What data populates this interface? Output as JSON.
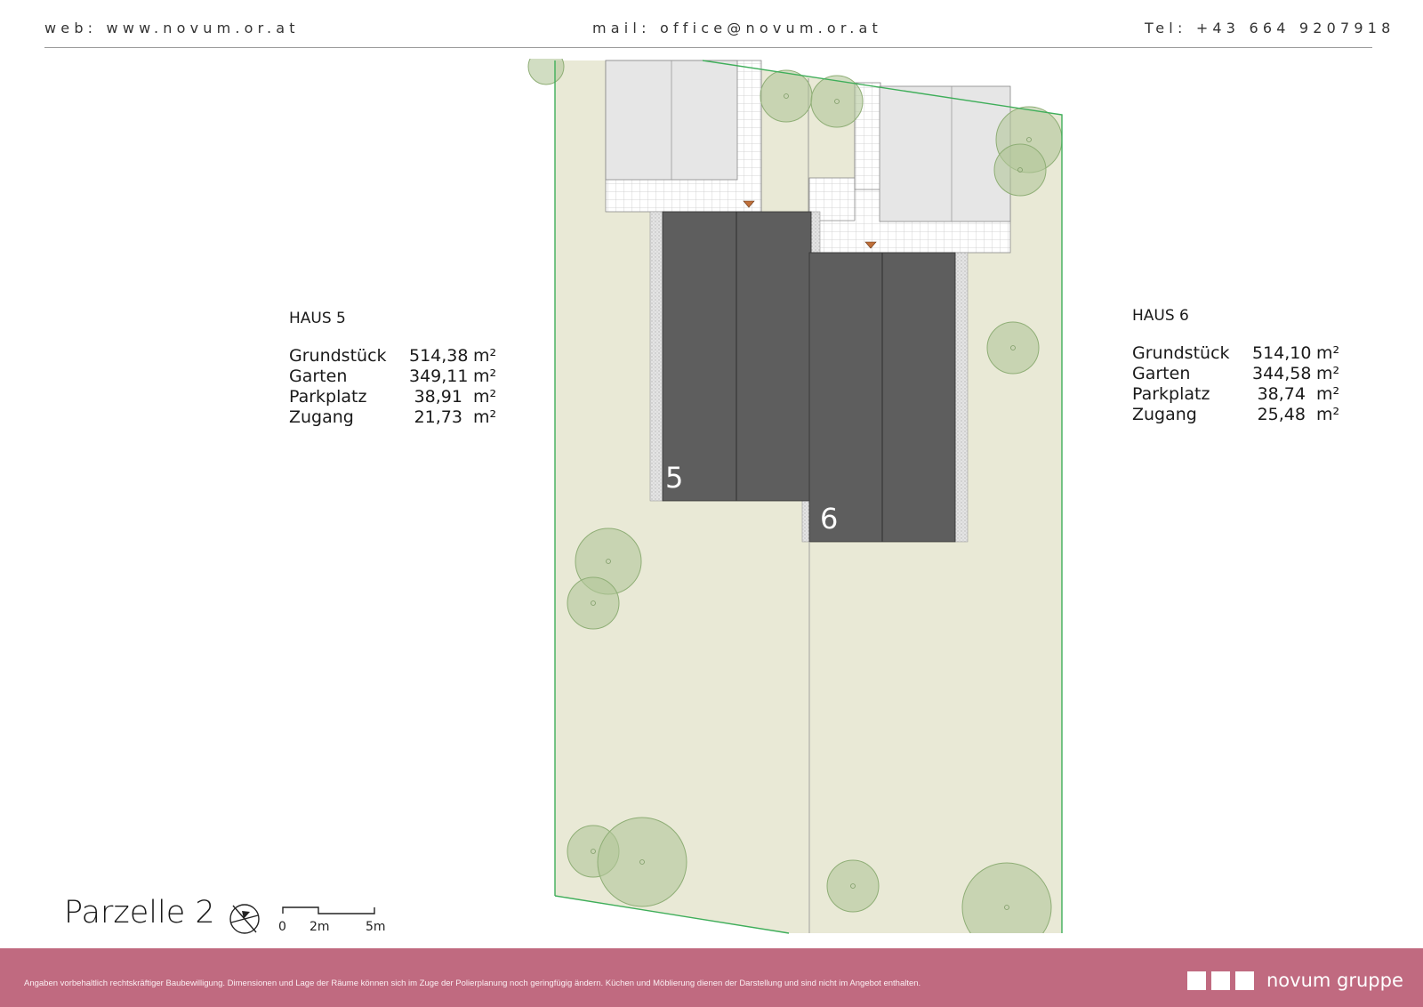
{
  "header": {
    "web": "web: www.novum.or.at",
    "mail": "mail: office@novum.or.at",
    "tel": "Tel: +43 664 9207918"
  },
  "plan": {
    "house_labels": [
      "5",
      "6"
    ],
    "colors": {
      "garden": "#e9e9d6",
      "house_roof": "#5e5e5e",
      "neighbor_building": "#e6e6e6",
      "tree": "#b3c79a",
      "boundary": "#3fae5a",
      "door_marker": "#c0703a"
    }
  },
  "haus5": {
    "title": "HAUS 5",
    "rows": [
      {
        "label": "Grundstück",
        "value": "514,38",
        "unit": "m²"
      },
      {
        "label": "Garten",
        "value": "349,11",
        "unit": "m²"
      },
      {
        "label": "Parkplatz",
        "value": "38,91",
        "unit": "m²"
      },
      {
        "label": "Zugang",
        "value": "21,73",
        "unit": "m²"
      }
    ]
  },
  "haus6": {
    "title": "HAUS 6",
    "rows": [
      {
        "label": "Grundstück",
        "value": "514,10",
        "unit": "m²"
      },
      {
        "label": "Garten",
        "value": "344,58",
        "unit": "m²"
      },
      {
        "label": "Parkplatz",
        "value": "38,74",
        "unit": "m²"
      },
      {
        "label": "Zugang",
        "value": "25,48",
        "unit": "m²"
      }
    ]
  },
  "legend": {
    "title": "Parzelle 2",
    "compass_icon": "north-arrow-icon",
    "scale_labels": [
      "0",
      "2m",
      "5m"
    ]
  },
  "footer": {
    "disclaimer": "Angaben vorbehaltlich rechtskräftiger Baubewilligung. Dimensionen und Lage der Räume können sich im Zuge der Polierplanung noch geringfügig ändern. Küchen und Möblierung dienen der Darstellung und sind nicht im Angebot enthalten.",
    "brand": "novum gruppe",
    "brand_color": "#c06a80"
  }
}
